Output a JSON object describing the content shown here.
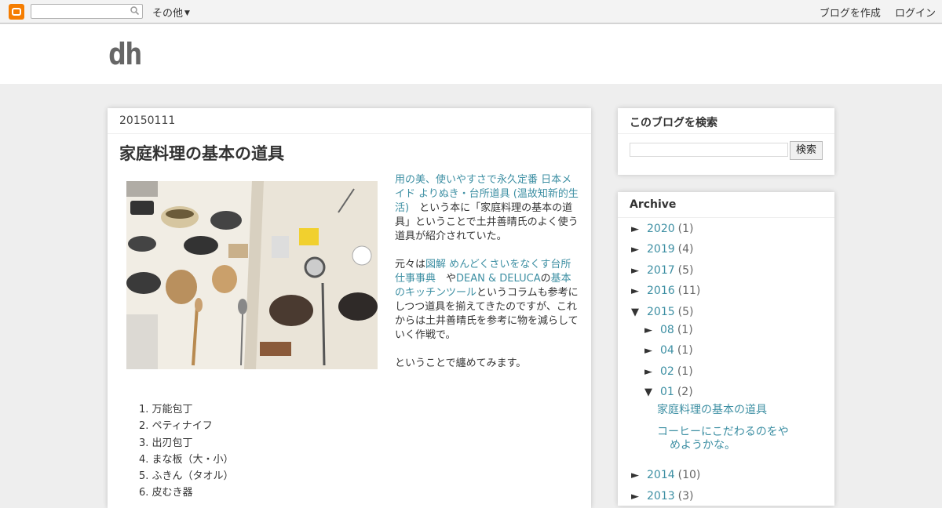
{
  "navbar": {
    "more_label": "その他",
    "create_blog": "ブログを作成",
    "login": "ログイン",
    "search_placeholder": ""
  },
  "header": {
    "site_title": "dh"
  },
  "post": {
    "date": "20150111",
    "title": "家庭料理の基本の道具",
    "book_link": "用の美、使いやすさで永久定番 日本メイド よりぬき・台所道具 (温故知新的生活)",
    "para1_rest": "という本に「家庭料理の基本の道具」ということで土井善晴氏のよく使う道具が紹介されていた。",
    "para2_prefix": "元々は",
    "link2": "図解 めんどくさいをなくす台所仕事事典",
    "para2_mid1": "や",
    "link3": "DEAN & DELUCA",
    "para2_mid2": "の",
    "link4": "基本のキッチンツール",
    "para2_rest": "というコラムも参考にしつつ道具を揃えてきたのですが、これからは土井善晴氏を参考に物を減らしていく作戦で。",
    "para3": "ということで纏めてみます。",
    "list": [
      "1. 万能包丁",
      "2. ペティナイフ",
      "3. 出刃包丁",
      "4. まな板（大・小）",
      "5. ふきん（タオル）",
      "6. 皮むき器"
    ]
  },
  "sidebar": {
    "search_title": "このブログを検索",
    "search_button": "検索",
    "archive_title": "Archive",
    "archive": [
      {
        "toggle": "►",
        "label": "2020",
        "count": "(1)"
      },
      {
        "toggle": "►",
        "label": "2019",
        "count": "(4)"
      },
      {
        "toggle": "►",
        "label": "2017",
        "count": "(5)"
      },
      {
        "toggle": "►",
        "label": "2016",
        "count": "(11)"
      },
      {
        "toggle": "▼",
        "label": "2015",
        "count": "(5)"
      },
      {
        "toggle": "►",
        "label": "08",
        "count": "(1)"
      },
      {
        "toggle": "►",
        "label": "04",
        "count": "(1)"
      },
      {
        "toggle": "►",
        "label": "02",
        "count": "(1)"
      },
      {
        "toggle": "▼",
        "label": "01",
        "count": "(2)"
      },
      {
        "toggle": "►",
        "label": "2014",
        "count": "(10)"
      },
      {
        "toggle": "►",
        "label": "2013",
        "count": "(3)"
      }
    ],
    "posts": [
      "家庭料理の基本の道具",
      "コーヒーにこだわるのをやめようかな。"
    ]
  }
}
